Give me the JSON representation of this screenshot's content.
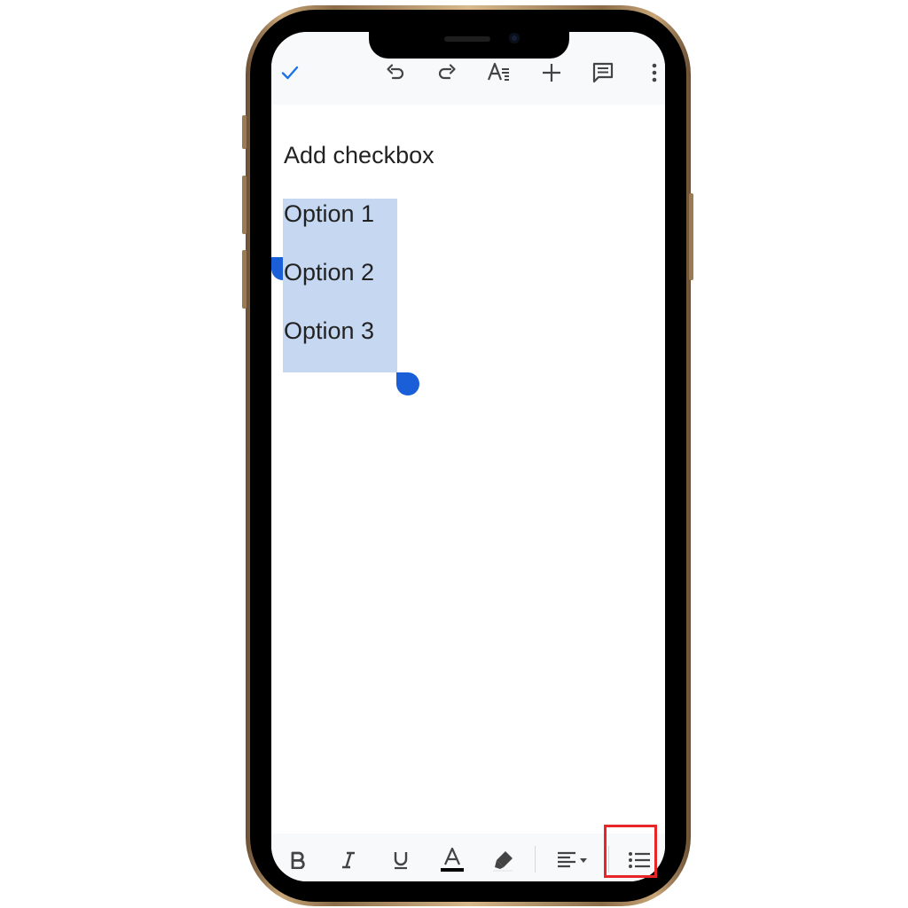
{
  "document": {
    "heading": "Add checkbox",
    "options": [
      "Option 1",
      "Option 2",
      "Option 3"
    ]
  },
  "toolbar": {
    "top": [
      "check-icon",
      "undo-icon",
      "redo-icon",
      "text-format-icon",
      "add-icon",
      "comment-icon",
      "more-vert-icon"
    ],
    "bottom": [
      "bold-icon",
      "italic-icon",
      "underline-icon",
      "text-color-icon",
      "highlight-icon",
      "align-left-icon",
      "bulleted-list-icon"
    ]
  },
  "colors": {
    "accent": "#1a73e8",
    "selection": "#c5d7f1",
    "selection_handle": "#1a5fd8",
    "highlight_box": "#e8262a",
    "text_color_underline": "#000000"
  }
}
